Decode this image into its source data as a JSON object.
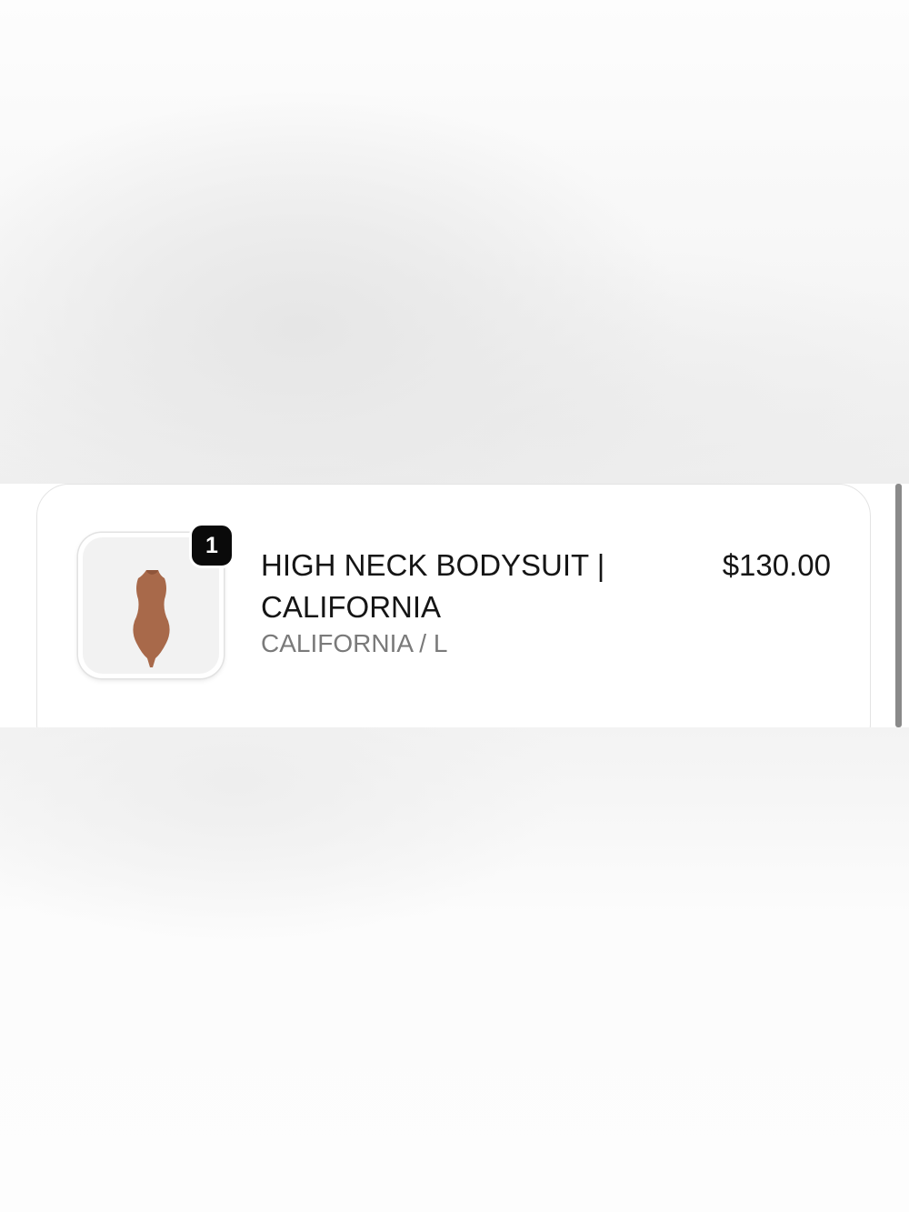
{
  "order_summary": {
    "items": [
      {
        "quantity": "1",
        "title": "HIGH NECK BODYSUIT | CALIFORNIA",
        "variant": "CALIFORNIA / L",
        "price": "$130.00",
        "image_icon": "bodysuit-product-image",
        "image_color": "#a8694a"
      }
    ]
  },
  "colors": {
    "badge_background": "#0a0a0a",
    "title_text": "#151515",
    "variant_text": "#7a7a7a"
  }
}
